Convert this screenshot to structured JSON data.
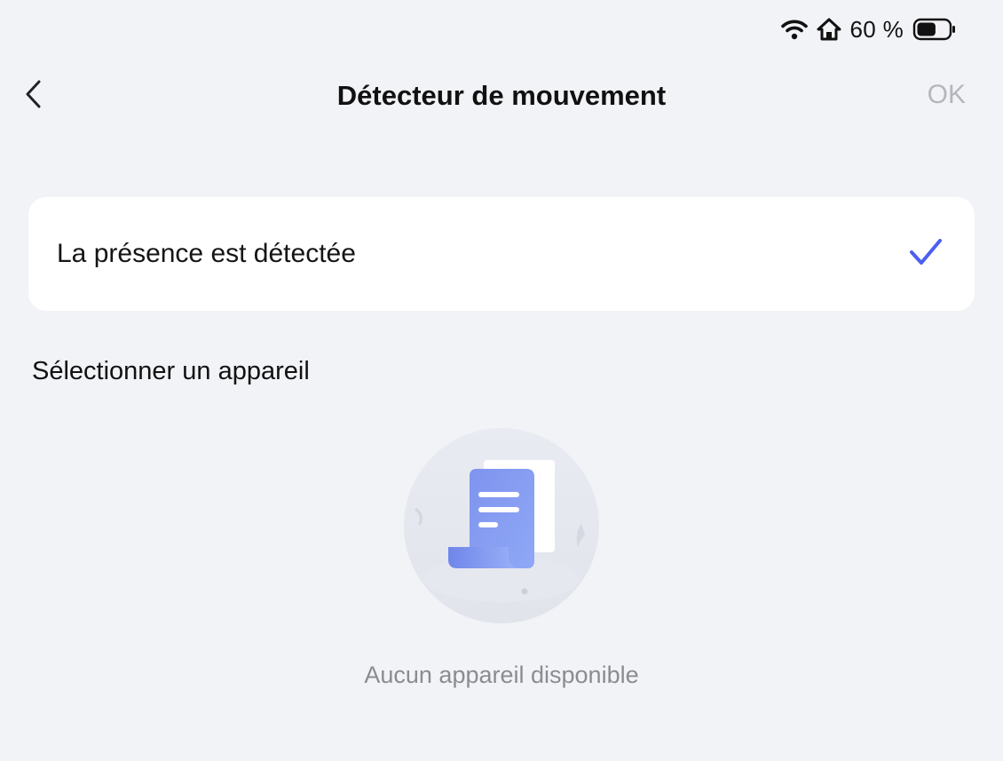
{
  "status_bar": {
    "battery_percent": "60 %",
    "icons": [
      "wifi-icon",
      "home-icon",
      "battery-icon"
    ],
    "battery_level": 0.6
  },
  "header": {
    "title": "Détecteur de mouvement",
    "back_icon": "chevron-left-icon",
    "ok_label": "OK"
  },
  "option": {
    "label": "La présence est détectée",
    "selected": true,
    "check_icon": "checkmark-icon"
  },
  "section": {
    "title": "Sélectionner un appareil"
  },
  "empty_state": {
    "icon": "empty-document-icon",
    "message": "Aucun appareil disponible"
  },
  "colors": {
    "background": "#f2f3f7",
    "card": "#ffffff",
    "accent": "#4b5ff0",
    "disabled_text": "#b4b6bb",
    "muted_text": "#8a8c91"
  }
}
